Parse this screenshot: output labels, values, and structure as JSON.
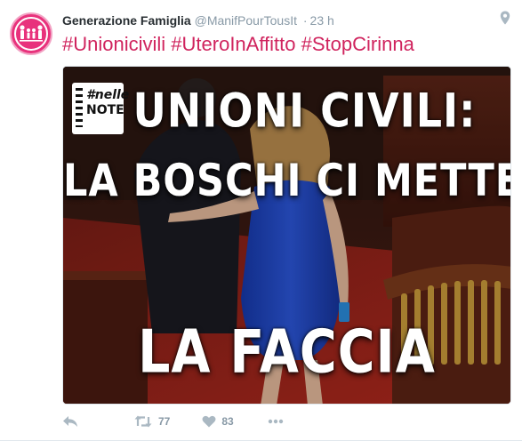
{
  "tweet": {
    "author_name": "Generazione Famiglia",
    "author_handle": "@ManifPourTousIt",
    "separator": "·",
    "time": "23 h",
    "hashtags": [
      "#Unionicivili",
      "#UteroInAffitto",
      "#StopCirinna"
    ],
    "location_icon": "map-pin-icon",
    "avatar_icon": "family-logo-icon"
  },
  "media": {
    "badge_top": "#nelle",
    "badge_bottom": "NOTE",
    "headline_line1": "UNIONI CIVILI:",
    "headline_line2": "LA BOSCHI CI METTE",
    "headline_line3": "LA FACCIA"
  },
  "actions": {
    "reply_icon": "reply-icon",
    "retweet_icon": "retweet-icon",
    "retweet_count": "77",
    "like_icon": "heart-icon",
    "like_count": "83",
    "more_icon": "more-icon"
  },
  "colors": {
    "hashtag": "#d0245e",
    "avatar": "#e8327c",
    "muted": "#8899a6",
    "icon": "#aab8c2"
  }
}
